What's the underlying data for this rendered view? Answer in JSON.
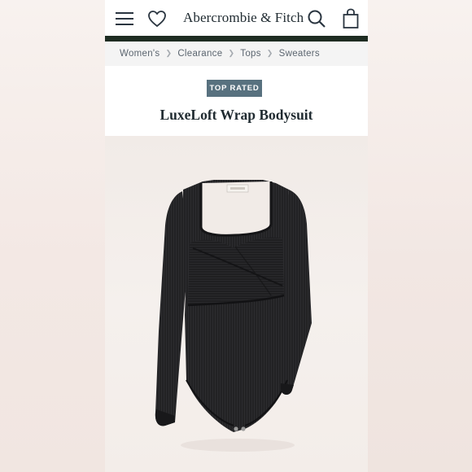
{
  "header": {
    "brand": "Abercrombie & Fitch",
    "icons": [
      "menu-icon",
      "heart-icon",
      "search-icon",
      "shopping-bag-icon"
    ]
  },
  "breadcrumb": [
    "Women's",
    "Clearance",
    "Tops",
    "Sweaters"
  ],
  "product": {
    "badge": "TOP RATED",
    "title": "LuxeLoft Wrap Bodysuit"
  },
  "colors": {
    "header_bar": "#1e2c22",
    "badge_bg": "#58717f",
    "garment": "#232325"
  }
}
